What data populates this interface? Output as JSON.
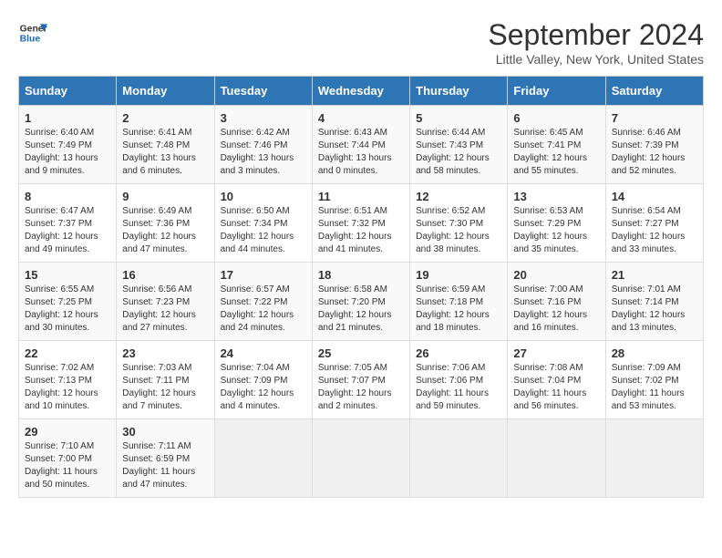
{
  "header": {
    "logo_line1": "General",
    "logo_line2": "Blue",
    "month": "September 2024",
    "location": "Little Valley, New York, United States"
  },
  "days_of_week": [
    "Sunday",
    "Monday",
    "Tuesday",
    "Wednesday",
    "Thursday",
    "Friday",
    "Saturday"
  ],
  "weeks": [
    [
      {
        "day": "1",
        "sunrise": "6:40 AM",
        "sunset": "7:49 PM",
        "daylight": "13 hours and 9 minutes."
      },
      {
        "day": "2",
        "sunrise": "6:41 AM",
        "sunset": "7:48 PM",
        "daylight": "13 hours and 6 minutes."
      },
      {
        "day": "3",
        "sunrise": "6:42 AM",
        "sunset": "7:46 PM",
        "daylight": "13 hours and 3 minutes."
      },
      {
        "day": "4",
        "sunrise": "6:43 AM",
        "sunset": "7:44 PM",
        "daylight": "13 hours and 0 minutes."
      },
      {
        "day": "5",
        "sunrise": "6:44 AM",
        "sunset": "7:43 PM",
        "daylight": "12 hours and 58 minutes."
      },
      {
        "day": "6",
        "sunrise": "6:45 AM",
        "sunset": "7:41 PM",
        "daylight": "12 hours and 55 minutes."
      },
      {
        "day": "7",
        "sunrise": "6:46 AM",
        "sunset": "7:39 PM",
        "daylight": "12 hours and 52 minutes."
      }
    ],
    [
      {
        "day": "8",
        "sunrise": "6:47 AM",
        "sunset": "7:37 PM",
        "daylight": "12 hours and 49 minutes."
      },
      {
        "day": "9",
        "sunrise": "6:49 AM",
        "sunset": "7:36 PM",
        "daylight": "12 hours and 47 minutes."
      },
      {
        "day": "10",
        "sunrise": "6:50 AM",
        "sunset": "7:34 PM",
        "daylight": "12 hours and 44 minutes."
      },
      {
        "day": "11",
        "sunrise": "6:51 AM",
        "sunset": "7:32 PM",
        "daylight": "12 hours and 41 minutes."
      },
      {
        "day": "12",
        "sunrise": "6:52 AM",
        "sunset": "7:30 PM",
        "daylight": "12 hours and 38 minutes."
      },
      {
        "day": "13",
        "sunrise": "6:53 AM",
        "sunset": "7:29 PM",
        "daylight": "12 hours and 35 minutes."
      },
      {
        "day": "14",
        "sunrise": "6:54 AM",
        "sunset": "7:27 PM",
        "daylight": "12 hours and 33 minutes."
      }
    ],
    [
      {
        "day": "15",
        "sunrise": "6:55 AM",
        "sunset": "7:25 PM",
        "daylight": "12 hours and 30 minutes."
      },
      {
        "day": "16",
        "sunrise": "6:56 AM",
        "sunset": "7:23 PM",
        "daylight": "12 hours and 27 minutes."
      },
      {
        "day": "17",
        "sunrise": "6:57 AM",
        "sunset": "7:22 PM",
        "daylight": "12 hours and 24 minutes."
      },
      {
        "day": "18",
        "sunrise": "6:58 AM",
        "sunset": "7:20 PM",
        "daylight": "12 hours and 21 minutes."
      },
      {
        "day": "19",
        "sunrise": "6:59 AM",
        "sunset": "7:18 PM",
        "daylight": "12 hours and 18 minutes."
      },
      {
        "day": "20",
        "sunrise": "7:00 AM",
        "sunset": "7:16 PM",
        "daylight": "12 hours and 16 minutes."
      },
      {
        "day": "21",
        "sunrise": "7:01 AM",
        "sunset": "7:14 PM",
        "daylight": "12 hours and 13 minutes."
      }
    ],
    [
      {
        "day": "22",
        "sunrise": "7:02 AM",
        "sunset": "7:13 PM",
        "daylight": "12 hours and 10 minutes."
      },
      {
        "day": "23",
        "sunrise": "7:03 AM",
        "sunset": "7:11 PM",
        "daylight": "12 hours and 7 minutes."
      },
      {
        "day": "24",
        "sunrise": "7:04 AM",
        "sunset": "7:09 PM",
        "daylight": "12 hours and 4 minutes."
      },
      {
        "day": "25",
        "sunrise": "7:05 AM",
        "sunset": "7:07 PM",
        "daylight": "12 hours and 2 minutes."
      },
      {
        "day": "26",
        "sunrise": "7:06 AM",
        "sunset": "7:06 PM",
        "daylight": "11 hours and 59 minutes."
      },
      {
        "day": "27",
        "sunrise": "7:08 AM",
        "sunset": "7:04 PM",
        "daylight": "11 hours and 56 minutes."
      },
      {
        "day": "28",
        "sunrise": "7:09 AM",
        "sunset": "7:02 PM",
        "daylight": "11 hours and 53 minutes."
      }
    ],
    [
      {
        "day": "29",
        "sunrise": "7:10 AM",
        "sunset": "7:00 PM",
        "daylight": "11 hours and 50 minutes."
      },
      {
        "day": "30",
        "sunrise": "7:11 AM",
        "sunset": "6:59 PM",
        "daylight": "11 hours and 47 minutes."
      },
      null,
      null,
      null,
      null,
      null
    ]
  ]
}
